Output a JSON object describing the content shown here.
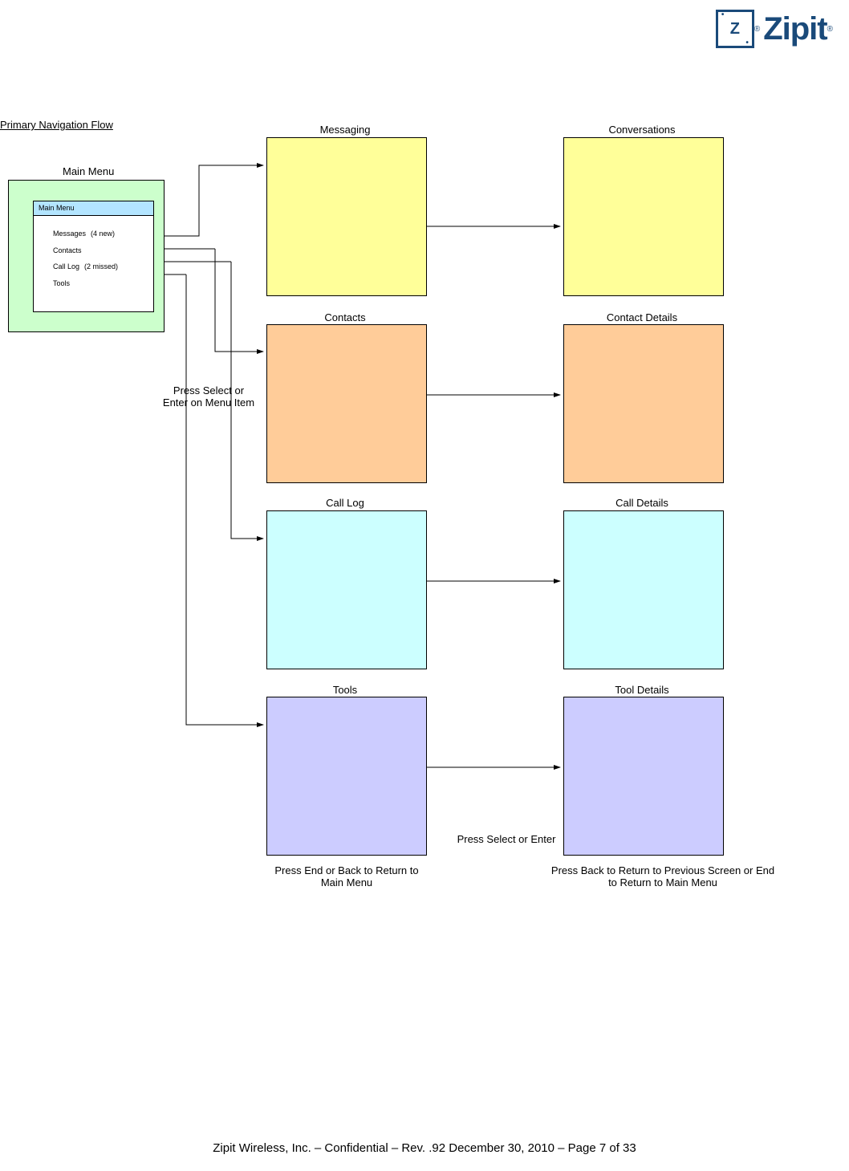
{
  "logo": {
    "brand": "Zipit",
    "mark": "Z"
  },
  "section_title": "Primary Navigation Flow",
  "main_menu": {
    "title": "Main Menu",
    "header": "Main Menu",
    "items": [
      {
        "label": "Messages",
        "badge": "(4 new)"
      },
      {
        "label": "Contacts",
        "badge": ""
      },
      {
        "label": "Call Log",
        "badge": "(2 missed)"
      },
      {
        "label": "Tools",
        "badge": ""
      }
    ]
  },
  "screens": {
    "col1": [
      {
        "label": "Messaging",
        "color": "yellow"
      },
      {
        "label": "Contacts",
        "color": "orange"
      },
      {
        "label": "Call Log",
        "color": "cyan"
      },
      {
        "label": "Tools",
        "color": "violet"
      }
    ],
    "col2": [
      {
        "label": "Conversations",
        "color": "yellow"
      },
      {
        "label": "Contact Details",
        "color": "orange"
      },
      {
        "label": "Call Details",
        "color": "cyan"
      },
      {
        "label": "Tool Details",
        "color": "violet"
      }
    ]
  },
  "captions": {
    "select_menu": "Press Select or Enter on Menu Item",
    "select_enter": "Press Select or Enter",
    "back_main": "Press End or Back to Return to Main Menu",
    "back_prev": "Press Back to Return to Previous Screen or End to Return to Main Menu"
  },
  "footer": "Zipit Wireless, Inc. – Confidential – Rev. .92 December 30, 2010 – Page 7 of 33"
}
